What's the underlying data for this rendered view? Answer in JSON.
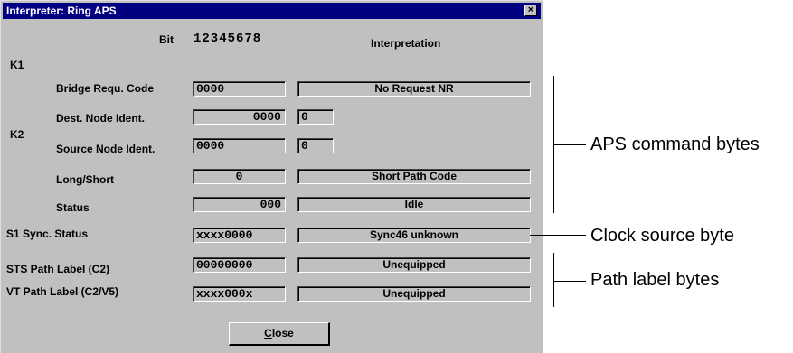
{
  "window": {
    "title": "Interpreter: Ring APS",
    "close_glyph": "×"
  },
  "header": {
    "bit_label": "Bit",
    "bit_numbers": "12345678",
    "interpretation_label": "Interpretation"
  },
  "groups": {
    "k1": "K1",
    "k2": "K2"
  },
  "rows": {
    "bridge": {
      "label": "Bridge Requ. Code",
      "bits": "0000",
      "interp": "No Request NR"
    },
    "dest": {
      "label": "Dest. Node Ident.",
      "bits": "0000",
      "interp": "0"
    },
    "source": {
      "label": "Source Node Ident.",
      "bits": "0000",
      "interp": "0"
    },
    "long_short": {
      "label": "Long/Short",
      "bits": "0",
      "interp": "Short Path Code"
    },
    "status": {
      "label": "Status",
      "bits": "000",
      "interp": "Idle"
    },
    "s1": {
      "label": "S1 Sync. Status",
      "bits": "xxxx0000",
      "interp": "Sync46 unknown"
    },
    "sts": {
      "label": "STS Path Label (C2)",
      "bits": "00000000",
      "interp": "Unequipped"
    },
    "vt": {
      "label": "VT Path Label (C2/V5)",
      "bits": "xxxx000x",
      "interp": "Unequipped"
    }
  },
  "close_button": {
    "mnemonic": "C",
    "rest": "lose"
  },
  "annotations": {
    "aps": "APS command bytes",
    "clock": "Clock source byte",
    "path": "Path label bytes"
  }
}
